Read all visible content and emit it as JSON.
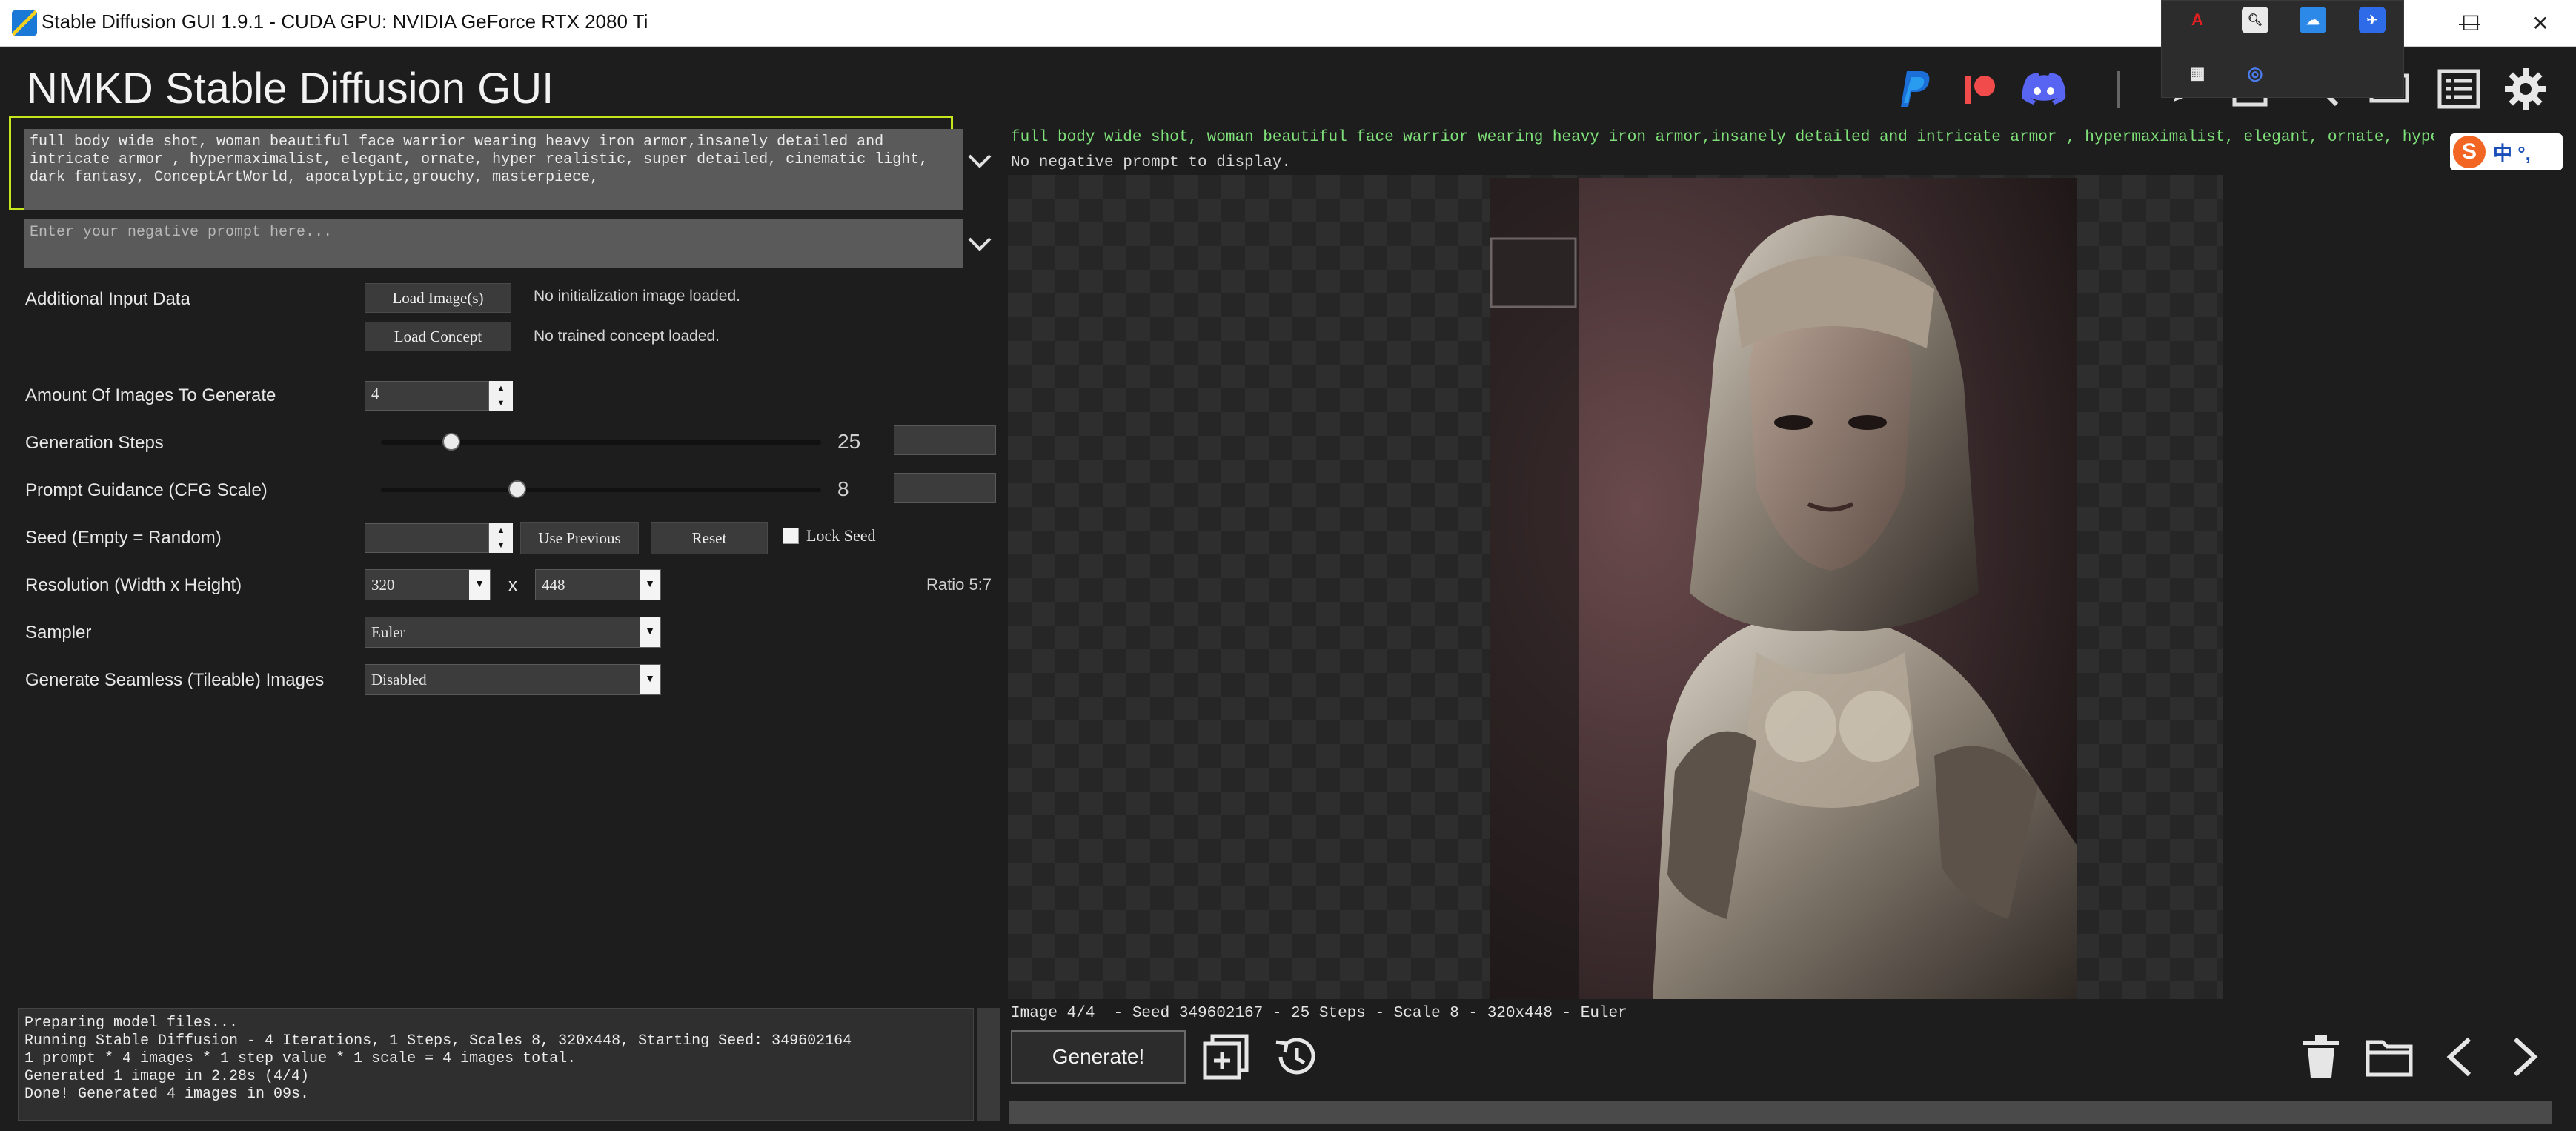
{
  "window": {
    "title": "Stable Diffusion GUI 1.9.1 - CUDA GPU: NVIDIA GeForce RTX 2080 Ti",
    "controls": [
      "—",
      "☐",
      "✕"
    ]
  },
  "tray": {
    "icons": [
      "acrobat-icon",
      "search-icon",
      "onedrive-icon",
      "feishu-icon",
      "docker-icon",
      "browser-icon"
    ]
  },
  "header": {
    "app_title": "NMKD Stable Diffusion GUI",
    "buttons": [
      "paypal-icon",
      "patreon-icon",
      "discord-icon",
      "edit-icon",
      "screenshot-icon",
      "search-icon",
      "install-icon",
      "list-icon",
      "gear-icon"
    ]
  },
  "prompt": {
    "text": "full body wide shot, woman beautiful face warrior wearing heavy iron armor,insanely detailed and\nintricate armor , hypermaximalist, elegant, ornate, hyper realistic, super detailed, cinematic light,\ndark fantasy, ConceptArtWorld, apocalyptic,grouchy, masterpiece,",
    "negative_placeholder": "Enter your negative prompt here..."
  },
  "settings": {
    "additional_input": {
      "label": "Additional Input Data",
      "load_image": "Load Image(s)",
      "init_status": "No initialization image loaded.",
      "load_concept": "Load Concept",
      "concept_status": "No trained concept loaded."
    },
    "amount": {
      "label": "Amount Of Images To Generate",
      "value": "4"
    },
    "steps": {
      "label": "Generation Steps",
      "value": "25",
      "slider_fraction": 0.16
    },
    "cfg": {
      "label": "Prompt Guidance (CFG Scale)",
      "value": "8",
      "slider_fraction": 0.31
    },
    "seed": {
      "label": "Seed (Empty = Random)",
      "value": "",
      "use_previous": "Use Previous",
      "reset": "Reset",
      "lock_seed": "Lock Seed"
    },
    "resolution": {
      "label": "Resolution (Width x Height)",
      "width": "320",
      "x": "x",
      "height": "448",
      "ratio": "Ratio 5:7"
    },
    "sampler": {
      "label": "Sampler",
      "value": "Euler"
    },
    "seamless": {
      "label": "Generate Seamless (Tileable) Images",
      "value": "Disabled"
    }
  },
  "log": {
    "lines": [
      "Preparing model files...",
      "Running Stable Diffusion - 4 Iterations, 1 Steps, Scales 8, 320x448, Starting Seed: 349602164",
      "1 prompt * 4 images * 1 step value * 1 scale = 4 images total.",
      "Generated 1 image in 2.28s (4/4)",
      "Done! Generated 4 images in 09s."
    ]
  },
  "preview": {
    "prompt_line": "full body wide shot, woman beautiful face warrior wearing heavy iron armor,insanely detailed and intricate armor , hypermaximalist, elegant, ornate, hyper realistic, super",
    "negative_line": "No negative prompt to display.",
    "image_info": "Image 4/4  - Seed 349602167 - 25 Steps - Scale 8 - 320x448 - Euler",
    "ime_badge": "中 °,"
  },
  "bottom": {
    "generate": "Generate!",
    "icons": [
      "add-queue-icon",
      "history-icon",
      "delete-icon",
      "folder-icon",
      "prev-icon",
      "next-icon"
    ]
  },
  "colors": {
    "accent_prompt_border": "#c8e61e",
    "prompt_preview_text": "#7fe07a",
    "background": "#1d1d1d"
  }
}
